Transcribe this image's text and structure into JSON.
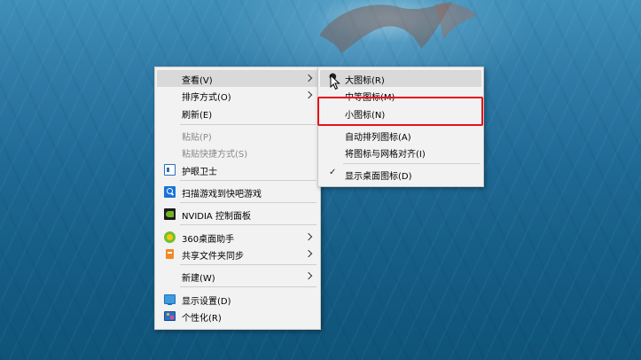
{
  "context_menu": {
    "items": [
      {
        "label": "查看(V)",
        "submenu": true,
        "highlighted": true
      },
      {
        "label": "排序方式(O)",
        "submenu": true
      },
      {
        "label": "刷新(E)"
      },
      {
        "label": "粘贴(P)",
        "disabled": true
      },
      {
        "label": "粘贴快捷方式(S)",
        "disabled": true
      },
      {
        "label": "护眼卫士",
        "icon": "eye-guard-icon"
      },
      {
        "label": "扫描游戏到快吧游戏",
        "icon": "scan-icon"
      },
      {
        "label": "NVIDIA 控制面板",
        "icon": "nvidia-icon"
      },
      {
        "label": "360桌面助手",
        "icon": "360-icon",
        "submenu": true
      },
      {
        "label": "共享文件夹同步",
        "icon": "share-sync-icon",
        "submenu": true
      },
      {
        "label": "新建(W)",
        "submenu": true
      },
      {
        "label": "显示设置(D)",
        "icon": "display-icon"
      },
      {
        "label": "个性化(R)",
        "icon": "personalize-icon"
      }
    ]
  },
  "view_submenu": {
    "items": [
      {
        "label": "大图标(R)",
        "highlighted": true,
        "selected": true
      },
      {
        "label": "中等图标(M)"
      },
      {
        "label": "小图标(N)",
        "annotated": true
      },
      {
        "label": "自动排列图标(A)"
      },
      {
        "label": "将图标与网格对齐(I)"
      },
      {
        "label": "显示桌面图标(D)",
        "checked": true
      }
    ]
  },
  "colors": {
    "annotation_box": "#e8101a",
    "menu_bg": "#f2f2f2",
    "highlight": "#d9d9d9"
  }
}
